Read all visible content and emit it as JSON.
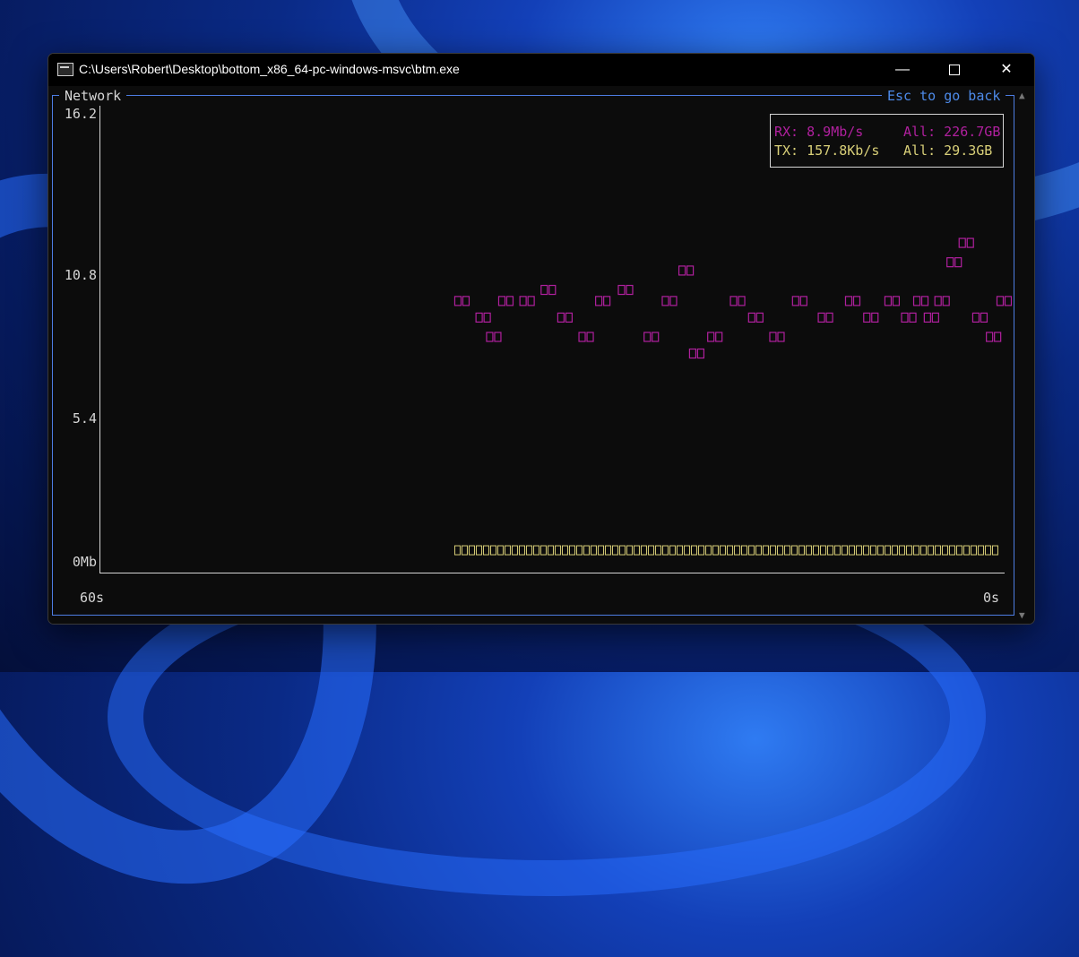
{
  "window": {
    "title": "C:\\Users\\Robert\\Desktop\\bottom_x86_64-pc-windows-msvc\\btm.exe",
    "minimize_glyph": "—",
    "close_glyph": "✕"
  },
  "panel": {
    "title": "Network",
    "esc_hint": "Esc to go back",
    "scroll_up": "▲",
    "scroll_down": "▼"
  },
  "legend": {
    "rx_label": "RX: 8.9Mb/s",
    "rx_total": "All: 226.7GB",
    "tx_label": "TX: 157.8Kb/s",
    "tx_total": "All: 29.3GB"
  },
  "colors": {
    "rx": "#b0209e",
    "tx": "#d8cf78",
    "axis": "#d6d6d6",
    "border": "#4d7de2"
  },
  "chart_data": {
    "type": "line",
    "x_unit": "seconds ago",
    "x_ticks": [
      "60s",
      "0s"
    ],
    "y_ticks": [
      "16.2",
      "10.8",
      "5.4",
      "0Mb"
    ],
    "xlim": [
      60,
      0
    ],
    "ylim": [
      0,
      16.2
    ],
    "series": [
      {
        "name": "RX",
        "x": [
          36.6,
          35.2,
          34.5,
          33.7,
          32.3,
          30.9,
          29.8,
          28.4,
          27.3,
          25.8,
          24.1,
          22.9,
          21.8,
          21.1,
          19.9,
          18.4,
          17.2,
          15.8,
          14.3,
          12.6,
          10.8,
          9.6,
          8.2,
          7.1,
          6.3,
          5.6,
          4.9,
          4.1,
          3.3,
          2.4,
          1.5,
          0.8
        ],
        "values": [
          9.4,
          8.8,
          8.1,
          9.4,
          9.4,
          9.8,
          8.8,
          8.1,
          9.4,
          9.8,
          8.1,
          9.4,
          10.5,
          7.5,
          8.1,
          9.4,
          8.8,
          8.1,
          9.4,
          8.8,
          9.4,
          8.8,
          9.4,
          8.8,
          9.4,
          8.8,
          9.4,
          10.8,
          11.5,
          8.8,
          8.1,
          9.4
        ]
      },
      {
        "name": "TX",
        "x": [
          36.6,
          30,
          24,
          18,
          12,
          6,
          0.8
        ],
        "values": [
          0.16,
          0.16,
          0.16,
          0.16,
          0.16,
          0.16,
          0.16
        ]
      }
    ]
  }
}
